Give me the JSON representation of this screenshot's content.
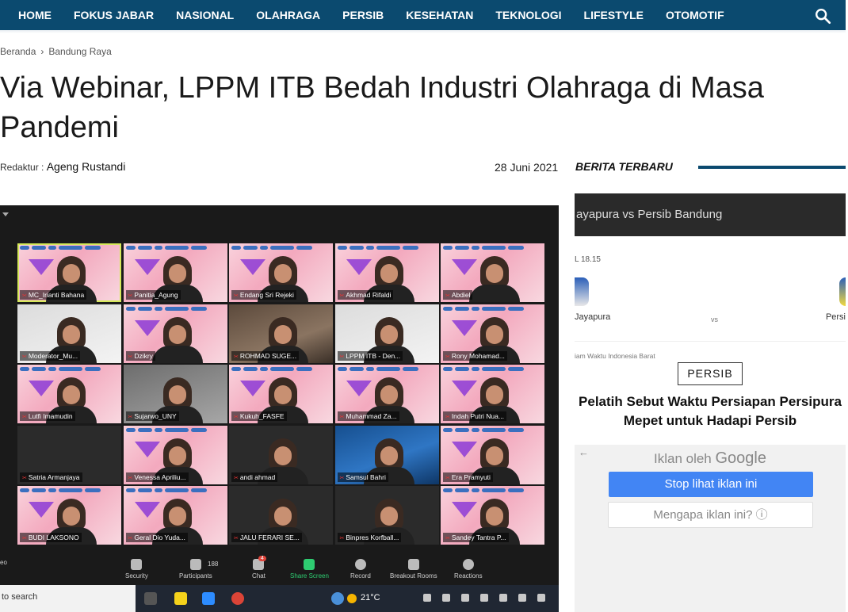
{
  "nav": {
    "items": [
      "HOME",
      "FOKUS JABAR",
      "NASIONAL",
      "OLAHRAGA",
      "PERSIB",
      "KESEHATAN",
      "TEKNOLOGI",
      "LIFESTYLE",
      "OTOMOTIF"
    ],
    "search_icon": "search-icon"
  },
  "breadcrumb": {
    "home": "Beranda",
    "separator": "›",
    "section": "Bandung Raya"
  },
  "article": {
    "title": "Via Webinar, LPPM ITB Bedah Industri Olahraga di Masa Pandemi",
    "editor_label": "Redaktur :",
    "editor_name": "Ageng Rustandi",
    "date": "28 Juni 2021"
  },
  "zoom": {
    "participants": [
      {
        "name": "MC_Irianti Bahana",
        "style": "pink"
      },
      {
        "name": "Panitia_Agung",
        "style": "pink"
      },
      {
        "name": "Endang Sri Rejeki",
        "style": "pink"
      },
      {
        "name": "Akhmad Rifaldi",
        "style": "pink"
      },
      {
        "name": "Abdiel",
        "style": "pink"
      },
      {
        "name": "Moderator_Mu...",
        "style": "light"
      },
      {
        "name": "Dzikry",
        "style": "pink"
      },
      {
        "name": "ROHMAD SUGE...",
        "style": "room"
      },
      {
        "name": "LPPM ITB - Den...",
        "style": "light"
      },
      {
        "name": "Rony Mohamad...",
        "style": "pink"
      },
      {
        "name": "Lutfi Imamudin",
        "style": "pink"
      },
      {
        "name": "Sujarwo_UNY",
        "style": "grey"
      },
      {
        "name": "Kukuh_FASFE",
        "style": "pink"
      },
      {
        "name": "Muhammad Za...",
        "style": "pink"
      },
      {
        "name": "Indah Putri Nua...",
        "style": "pink"
      },
      {
        "name": "Satria Armanjaya",
        "style": "dark"
      },
      {
        "name": "Venessa Apriliu...",
        "style": "pink"
      },
      {
        "name": "andi ahmad",
        "style": "dark"
      },
      {
        "name": "Samsul Bahri",
        "style": "blue"
      },
      {
        "name": "Era Pramyuti",
        "style": "pink"
      },
      {
        "name": "BUDI LAKSONO",
        "style": "pink"
      },
      {
        "name": "Geral Dio Yuda...",
        "style": "pink"
      },
      {
        "name": "JALU FERARI SE...",
        "style": "dark"
      },
      {
        "name": "Binpres Korfball...",
        "style": "dark"
      },
      {
        "name": "Sandey Tantra P...",
        "style": "pink"
      }
    ],
    "toolbar": {
      "video_label": "eo",
      "security": "Security",
      "participants": "Participants",
      "participants_count": "188",
      "chat": "Chat",
      "chat_badge": "4",
      "share": "Share Screen",
      "record": "Record",
      "breakout": "Breakout Rooms",
      "reactions": "Reactions"
    },
    "taskbar": {
      "search": "to search",
      "temperature": "21°C"
    }
  },
  "sidebar": {
    "heading": "BERITA TERBARU",
    "card": {
      "match": "ayapura vs Persib Bandung",
      "time": "L 18.15",
      "team_left": "Jayapura",
      "vs": "vs",
      "team_right": "Persi",
      "timezone": "iam Waktu Indonesia Barat"
    },
    "tag": "PERSIB",
    "headline": "Pelatih Sebut Waktu Persiapan Persipura Mepet untuk Hadapi Persib"
  },
  "ad": {
    "back_glyph": "←",
    "by_label": "Iklan oleh",
    "brand": "Google",
    "stop_button": "Stop lihat iklan ini",
    "why_button": "Mengapa iklan ini? ⓘ"
  },
  "colors": {
    "nav_bg": "#0b4a6f",
    "ad_button": "#4285f4"
  }
}
